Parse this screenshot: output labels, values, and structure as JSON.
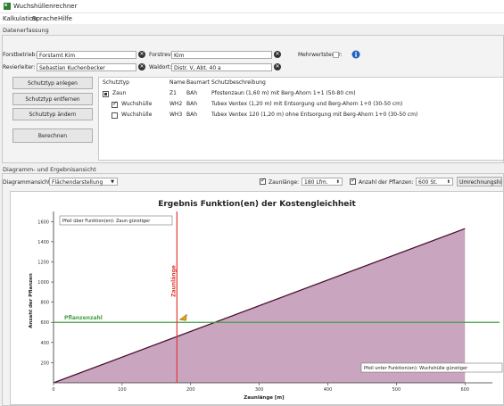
{
  "window": {
    "title": "Wuchshüllenrechner"
  },
  "menu": [
    "Kalkulation",
    "Sprache",
    "Hilfe"
  ],
  "data_entry": {
    "section_label": "Datenerfassung",
    "forstbetrieb_label": "Forstbetrieb:",
    "forstbetrieb_value": "Forstamt Kim",
    "forstrevier_label": "Forstrevier:",
    "forstrevier_value": "Kim",
    "mwst_label": "Mehrwertsteuer:",
    "revierleiter_label": "Revierleiter:",
    "revierleiter_value": "Sebastian Kuchenbecker",
    "waldort_label": "Waldort:",
    "waldort_value": "Distr. V, Abt. 40 a",
    "clear_glyph": "✕"
  },
  "buttons": {
    "add": "Schutztyp anlegen",
    "remove": "Schutztyp entfernen",
    "change": "Schutztyp ändern",
    "calc": "Berechnen"
  },
  "table": {
    "headers": [
      "Schutztyp",
      "Name",
      "Baumart",
      "Schutzbeschreibung"
    ],
    "rows": [
      {
        "type": "Zaun",
        "name": "Z1",
        "tree": "BAh",
        "desc": "Pfostenzaun (1,60 m) mit Berg-Ahorn 1+1 (50-80 cm)"
      },
      {
        "type": "Wuchshülle",
        "name": "WH2",
        "tree": "BAh",
        "desc": "Tubex Ventex (1,20 m) mit Entsorgung und Berg-Ahorn 1+0 (30-50 cm)"
      },
      {
        "type": "Wuchshülle",
        "name": "WH3",
        "tree": "BAh",
        "desc": "Tubex Ventex 120 (1,20 m) ohne Entsorgung mit Berg-Ahorn 1+0 (30-50 cm)"
      }
    ]
  },
  "diagram": {
    "section_label": "Diagramm- und Ergebnisansicht",
    "view_label": "Diagrammansicht:",
    "view_value": "Flächendarstellung",
    "fence_check_label": "Zaunlänge:",
    "fence_value": "180 Lfm.",
    "plants_check_label": "Anzahl der Pflanzen:",
    "plants_value": "600 St.",
    "extra_button": "Umrechnungshilfe"
  },
  "chart_data": {
    "type": "area",
    "title": "Ergebnis Funktion(en) der Kostengleichheit",
    "xlabel": "Zaunlänge [m]",
    "ylabel": "Anzahl der Pflanzen",
    "xlim": [
      0,
      640
    ],
    "ylim": [
      0,
      1700
    ],
    "xticks": [
      0,
      100,
      200,
      300,
      400,
      500,
      600
    ],
    "yticks": [
      200,
      400,
      600,
      800,
      1000,
      1200,
      1400,
      1600
    ],
    "series": [
      {
        "x": [
          0,
          600
        ],
        "y": [
          0,
          1530
        ],
        "color": "#4a1230",
        "fill": "#c9a5bf"
      }
    ],
    "vline": {
      "x": 180,
      "label": "Zaunlänge",
      "color": "#e53935"
    },
    "hline": {
      "y": 600,
      "label": "Pflanzenzahl",
      "color": "#43a047"
    },
    "annotations": {
      "above": "Pfeil über Funktion(en): Zaun günstiger",
      "below": "Pfeil unter Funktion(en): Wuchshülle günstiger"
    },
    "grid": false
  }
}
